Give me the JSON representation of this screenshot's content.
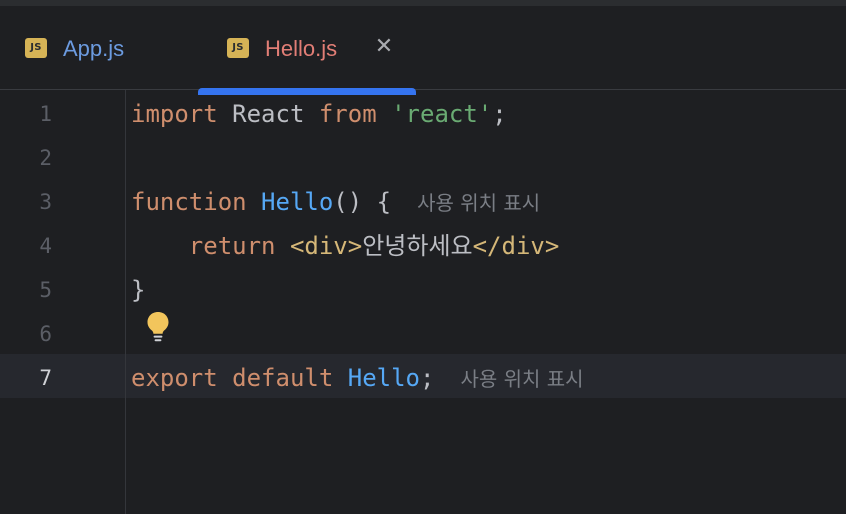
{
  "tabs": [
    {
      "icon_text": "JS",
      "label": "App.js"
    },
    {
      "icon_text": "JS",
      "label": "Hello.js",
      "close": "✕"
    }
  ],
  "line_numbers": [
    "1",
    "2",
    "3",
    "4",
    "5",
    "6",
    "7"
  ],
  "code": {
    "line1": {
      "kw1": "import",
      "name": " React ",
      "kw2": "from",
      "str": " 'react'",
      "semi": ";"
    },
    "line3": {
      "kw": "function",
      "fn": " Hello",
      "rest": "() {",
      "hint": "사용 위치 표시"
    },
    "line4": {
      "kw": "return",
      "tag_open": "<div>",
      "text": "안녕하세요",
      "tag_close": "</div>"
    },
    "line5": {
      "brace": "}"
    },
    "line7": {
      "kw": "export default",
      "fn": " Hello",
      "semi": ";",
      "hint": "사용 위치 표시"
    }
  },
  "colors": {
    "background": "#1e1f22",
    "keyword": "#cf8e6d",
    "string": "#6aab73",
    "function": "#56a8f5",
    "tag": "#d5b778",
    "active_tab_accent": "#3574f0"
  },
  "icons": {
    "intention_action": "lightbulb-icon"
  }
}
